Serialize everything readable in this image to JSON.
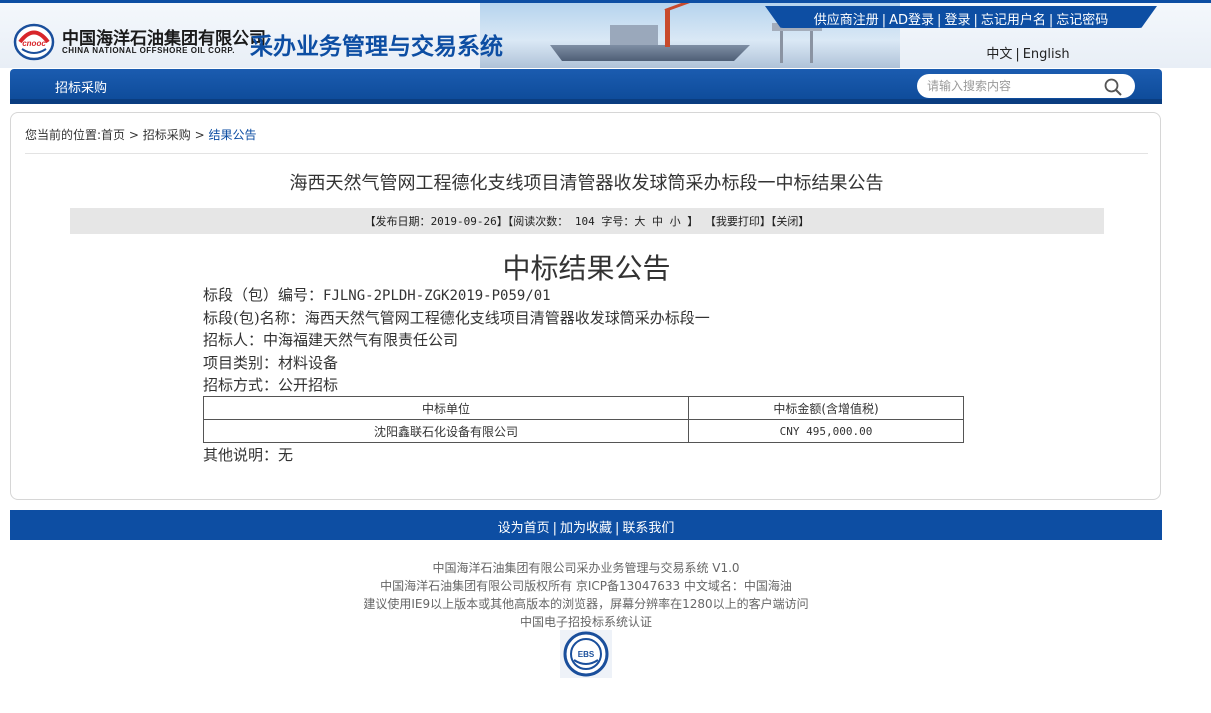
{
  "header": {
    "company_name_cn": "中国海洋石油集团有限公司",
    "company_name_en": "CHINA NATIONAL OFFSHORE OIL CORP.",
    "system_title": "采办业务管理与交易系统",
    "logo_text": "cnooc",
    "top_links": [
      "供应商注册",
      "AD登录",
      "登录",
      "忘记用户名",
      "忘记密码"
    ],
    "top_link_separator": "|",
    "languages": [
      "中文",
      "English"
    ]
  },
  "nav": {
    "items": [
      "招标采购"
    ],
    "search_placeholder": "请输入搜索内容",
    "search_icon": "search-icon"
  },
  "breadcrumb": {
    "prefix": "您当前的位置:",
    "items": [
      "首页",
      "招标采购",
      "结果公告"
    ],
    "separator": " > "
  },
  "article": {
    "title": "海西天然气管网工程德化支线项目清管器收发球筒采办标段一中标结果公告",
    "meta": {
      "publish_date_label": "【发布日期：",
      "publish_date": "2019-09-26",
      "read_count_label": "】【阅读次数：",
      "read_count": "104",
      "font_size_label": "字号：",
      "font_large": "大",
      "font_medium": "中",
      "font_small": "小",
      "font_close": "】",
      "print_label": "【我要打印】",
      "close_label": "【关闭】"
    },
    "heading": "中标结果公告",
    "fields": {
      "section_no_label": "标段（包）编号：",
      "section_no": "FJLNG-2PLDH-ZGK2019-P059/01",
      "section_name_label": "标段(包)名称：",
      "section_name": "海西天然气管网工程德化支线项目清管器收发球筒采办标段一",
      "tenderer_label": "招标人：",
      "tenderer": "中海福建天然气有限责任公司",
      "category_label": "项目类别：",
      "category": "材料设备",
      "method_label": "招标方式：",
      "method": "公开招标"
    },
    "table": {
      "headers": [
        "中标单位",
        "中标金额(含增值税)"
      ],
      "rows": [
        [
          "沈阳鑫联石化设备有限公司",
          "CNY 495,000.00"
        ]
      ]
    },
    "other_notes_label": "其他说明：",
    "other_notes": "无"
  },
  "footer": {
    "links": [
      "设为首页",
      "加为收藏",
      "联系我们"
    ],
    "info_lines": [
      "中国海洋石油集团有限公司采办业务管理与交易系统 V1.0",
      "中国海洋石油集团有限公司版权所有 京ICP备13047633 中文域名：中国海油",
      "建议使用IE9以上版本或其他高版本的浏览器，屏幕分辨率在1280以上的客户端访问",
      "中国电子招投标系统认证"
    ],
    "badge_text": "EBS"
  },
  "colors": {
    "brand_blue": "#0d4ea3",
    "logo_red": "#d8262b",
    "meta_bar_bg": "#e6e6e6",
    "text": "#333333"
  }
}
